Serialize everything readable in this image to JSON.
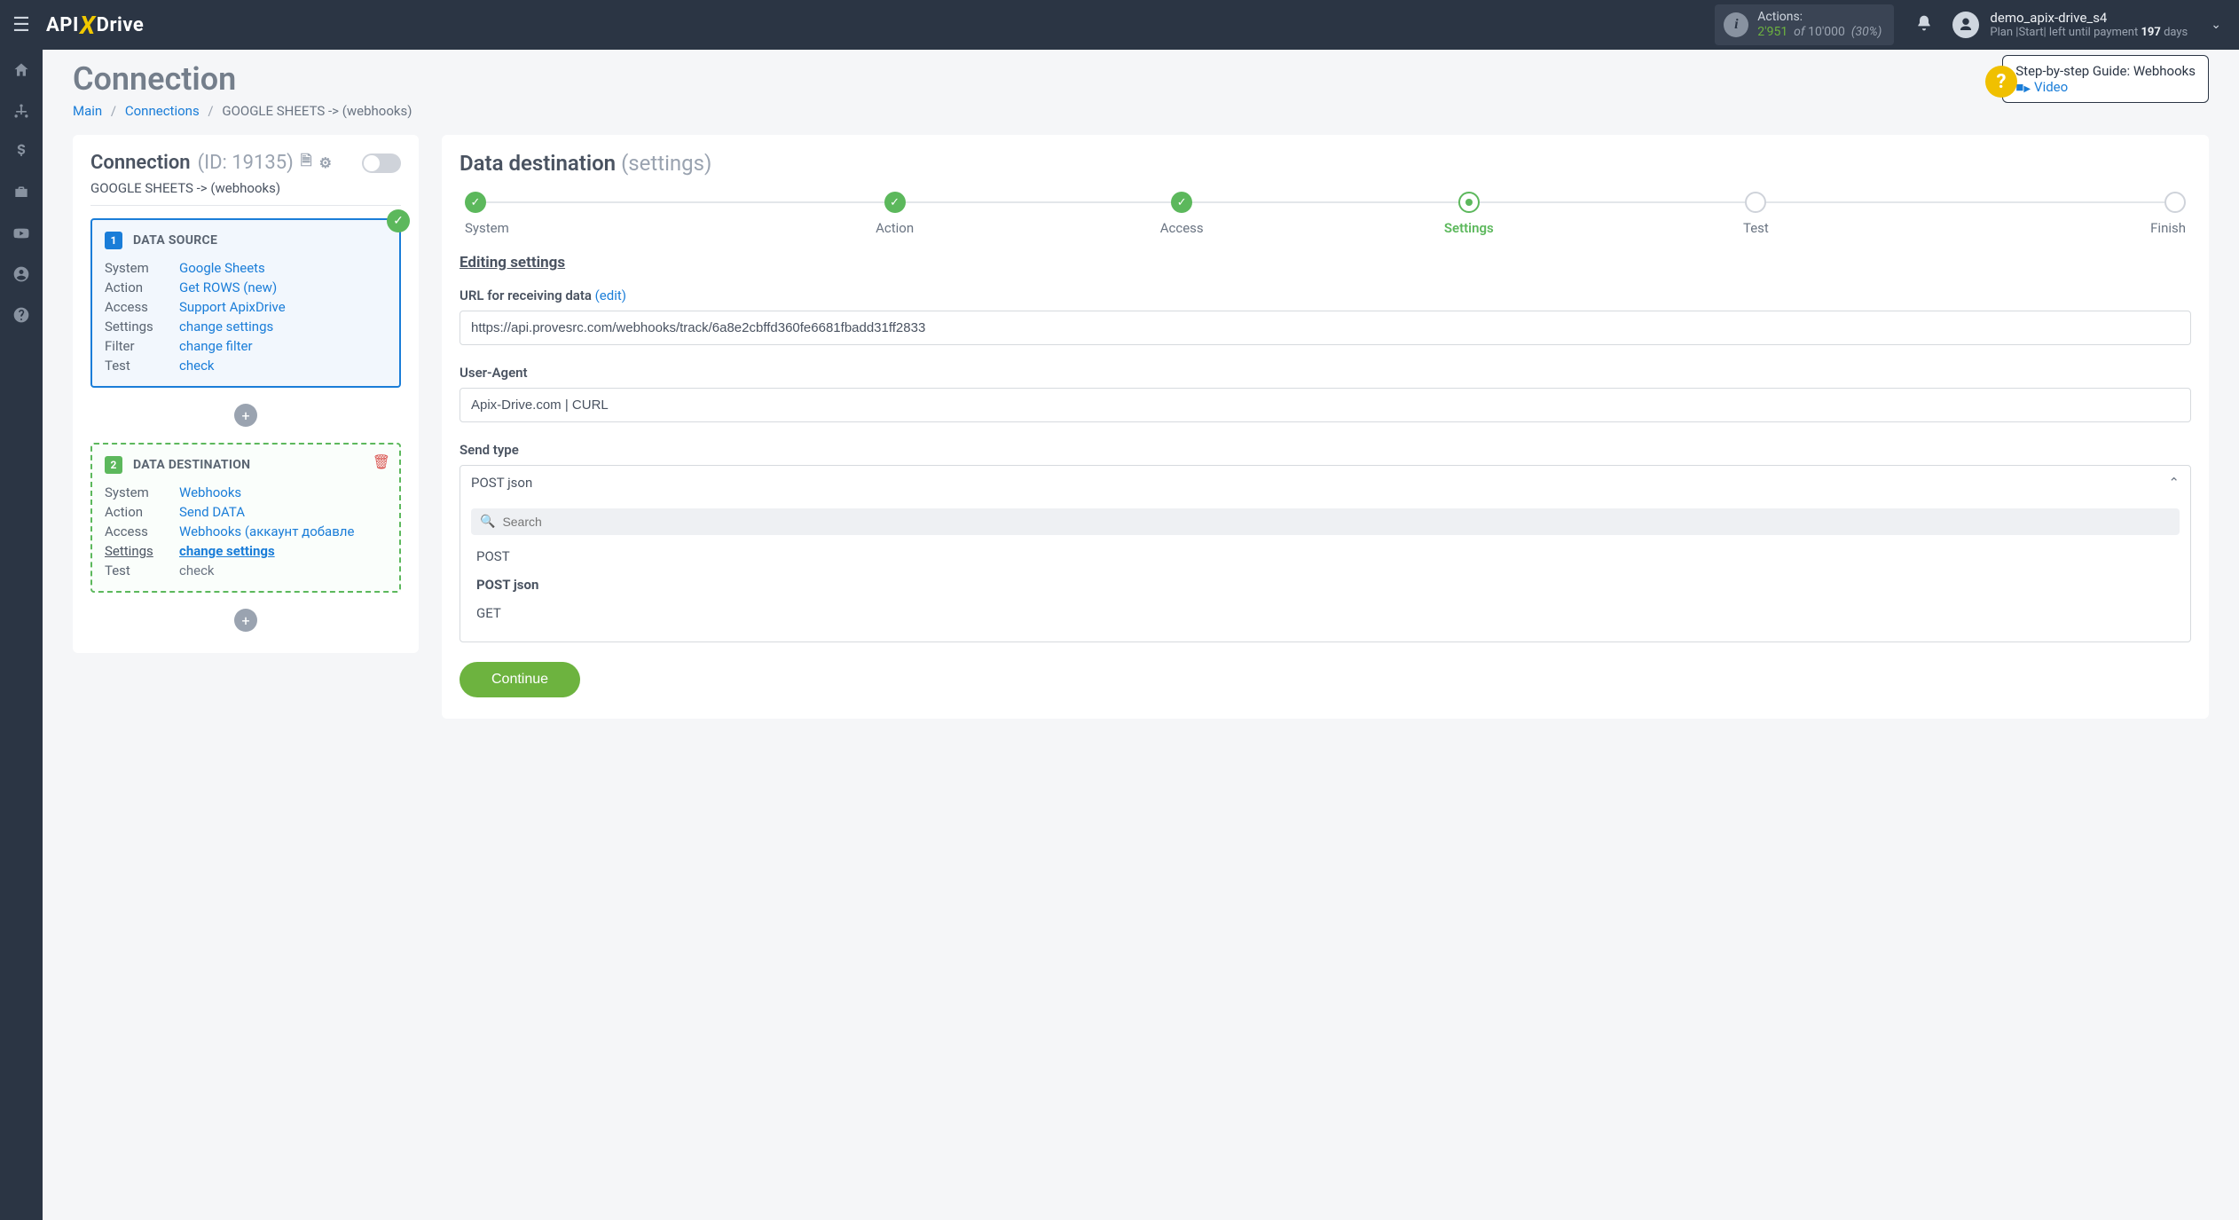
{
  "topbar": {
    "logo": {
      "a": "API",
      "x": "X",
      "b": "Drive"
    },
    "actions": {
      "label": "Actions:",
      "count": "2'951",
      "of": "of",
      "total": "10'000",
      "pct": "(30%)"
    },
    "user": {
      "name": "demo_apix-drive_s4",
      "plan_prefix": "Plan",
      "plan_name": "Start",
      "plan_suffix": "left until payment",
      "days": "197",
      "days_word": "days"
    }
  },
  "page": {
    "title": "Connection",
    "breadcrumb": {
      "main": "Main",
      "connections": "Connections",
      "current": "GOOGLE SHEETS -> (webhooks)"
    },
    "guide": {
      "title": "Step-by-step Guide: Webhooks",
      "video": "Video"
    }
  },
  "left": {
    "title": "Connection",
    "id": "(ID: 19135)",
    "subtitle": "GOOGLE SHEETS -> (webhooks)",
    "source": {
      "num": "1",
      "title": "DATA SOURCE",
      "rows": [
        {
          "k": "System",
          "v": "Google Sheets",
          "link": true
        },
        {
          "k": "Action",
          "v": "Get ROWS (new)",
          "link": true
        },
        {
          "k": "Access",
          "v": "Support ApixDrive",
          "link": true
        },
        {
          "k": "Settings",
          "v": "change settings",
          "link": true
        },
        {
          "k": "Filter",
          "v": "change filter",
          "link": true
        },
        {
          "k": "Test",
          "v": "check",
          "link": true
        }
      ]
    },
    "dest": {
      "num": "2",
      "title": "DATA DESTINATION",
      "rows": [
        {
          "k": "System",
          "v": "Webhooks",
          "link": true
        },
        {
          "k": "Action",
          "v": "Send DATA",
          "link": true
        },
        {
          "k": "Access",
          "v": "Webhooks (аккаунт добавле",
          "link": true
        },
        {
          "k": "Settings",
          "v": "change settings",
          "link": true,
          "hl": true
        },
        {
          "k": "Test",
          "v": "check",
          "link": false
        }
      ]
    }
  },
  "right": {
    "title": "Data destination",
    "subtitle": "(settings)",
    "steps": [
      {
        "label": "System",
        "state": "done"
      },
      {
        "label": "Action",
        "state": "done"
      },
      {
        "label": "Access",
        "state": "done"
      },
      {
        "label": "Settings",
        "state": "active"
      },
      {
        "label": "Test",
        "state": "todo"
      },
      {
        "label": "Finish",
        "state": "todo"
      }
    ],
    "section": "Editing settings",
    "url": {
      "label": "URL for receiving data",
      "edit": "(edit)",
      "value": "https://api.provesrc.com/webhooks/track/6a8e2cbffd360fe6681fbadd31ff2833"
    },
    "ua": {
      "label": "User-Agent",
      "value": "Apix-Drive.com | CURL"
    },
    "sendtype": {
      "label": "Send type",
      "selected": "POST json",
      "search_placeholder": "Search",
      "options": [
        "POST",
        "POST json",
        "GET"
      ]
    },
    "continue": "Continue"
  }
}
